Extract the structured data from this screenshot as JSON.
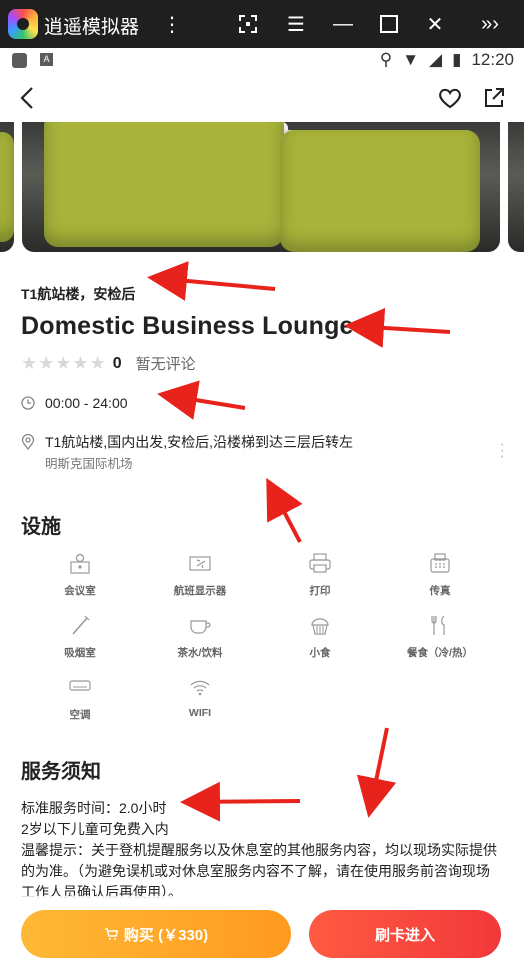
{
  "window": {
    "title": "逍遥模拟器"
  },
  "status_bar": {
    "time": "12:20"
  },
  "lounge": {
    "subtitle": "T1航站楼，安检后",
    "name": "Domestic Business Lounge",
    "rating_count": "0",
    "no_reviews": "暂无评论",
    "hours": "00:00 - 24:00",
    "location": "T1航站楼,国内出发,安检后,沿楼梯到达三层后转左",
    "airport": "明斯克国际机场"
  },
  "facilities": {
    "title": "设施",
    "items": [
      {
        "label": "会议室",
        "icon": "meeting-room-icon"
      },
      {
        "label": "航班显示器",
        "icon": "flight-display-icon"
      },
      {
        "label": "打印",
        "icon": "printer-icon"
      },
      {
        "label": "传真",
        "icon": "fax-icon"
      },
      {
        "label": "吸烟室",
        "icon": "smoking-room-icon"
      },
      {
        "label": "茶水/饮料",
        "icon": "tea-icon"
      },
      {
        "label": "小食",
        "icon": "snack-icon"
      },
      {
        "label": "餐食（冷/热）",
        "icon": "meal-icon"
      },
      {
        "label": "空调",
        "icon": "air-conditioner-icon"
      },
      {
        "label": "WIFI",
        "icon": "wifi-icon"
      }
    ]
  },
  "service": {
    "title": "服务须知",
    "line1": "标准服务时间：2.0小时",
    "line2": "2岁以下儿童可免费入内",
    "line3": "温馨提示：关于登机提醒服务以及休息室的其他服务内容，均以现场实际提供的为准。（为避免误机或对休息室服务内容不了解，请在使用服务前咨询现场工作人员确认后再使用）。"
  },
  "actions": {
    "buy_label": "购买 (￥330)",
    "card_label": "刷卡进入"
  },
  "colors": {
    "buy": "#ffa82a",
    "card": "#f2403b",
    "annotation": "#e8231b"
  }
}
